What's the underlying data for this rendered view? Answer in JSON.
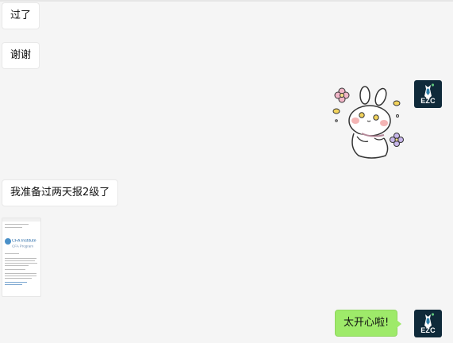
{
  "messages": [
    {
      "side": "left",
      "type": "text",
      "text": "过了"
    },
    {
      "side": "left",
      "type": "text",
      "text": "谢谢"
    },
    {
      "side": "right",
      "type": "sticker",
      "sticker": "bunny-blushing-flowers"
    },
    {
      "side": "left",
      "type": "text",
      "text": "我准备过两天报2级了"
    },
    {
      "side": "left",
      "type": "image",
      "image": {
        "brand": "CFA Institute",
        "subtitle": "CFA Program"
      }
    },
    {
      "side": "right",
      "type": "text",
      "text": "太开心啦!"
    }
  ],
  "avatar": {
    "label": "EZC",
    "icon": "tie-person-icon"
  },
  "colors": {
    "background": "#f5f5f5",
    "bubble_left": "#ffffff",
    "bubble_right": "#9eea6a",
    "avatar_bg": "#0f2a3a"
  }
}
